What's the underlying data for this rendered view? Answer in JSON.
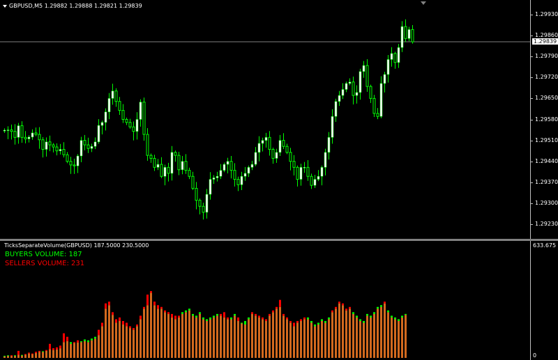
{
  "main_header": {
    "symbol": "GBPUSD,M5",
    "open": "1.29882",
    "high": "1.29888",
    "low": "1.29821",
    "close": "1.29839"
  },
  "sub_header": {
    "indicator": "TicksSeparateVolume(GBPUSD)",
    "value1": "187.5000",
    "value2": "230.5000"
  },
  "buyers_label": "BUYERS VOLUME: 187",
  "sellers_label": "SELLERS VOLUME: 231",
  "current_price": "1.29839",
  "price_ticks": [
    "1.29930",
    "1.29860",
    "1.29790",
    "1.29720",
    "1.29650",
    "1.29580",
    "1.29510",
    "1.29440",
    "1.29370",
    "1.29300",
    "1.29230"
  ],
  "volume_ticks": [
    "633.675",
    "0"
  ],
  "colors": {
    "buy": "#00ff00",
    "sell": "#ff0000",
    "bull": "#ffffff",
    "bear": "#00ff00",
    "grid": "#c0c0c0",
    "volume_fill": "#d2691e"
  },
  "chart_data": [
    {
      "type": "candlestick",
      "title": "GBPUSD,M5",
      "ylim": [
        1.292,
        1.2996
      ],
      "current_price": 1.29839,
      "closes": [
        1.29544,
        1.29545,
        1.2954,
        1.2952,
        1.29559,
        1.2952,
        1.29515,
        1.29521,
        1.29535,
        1.2953,
        1.29512,
        1.2948,
        1.29505,
        1.29495,
        1.29488,
        1.29475,
        1.2948,
        1.29462,
        1.2944,
        1.29428,
        1.29425,
        1.29458,
        1.2951,
        1.29495,
        1.29483,
        1.2949,
        1.29505,
        1.2956,
        1.2957,
        1.29605,
        1.2965,
        1.29675,
        1.2964,
        1.2961,
        1.2958,
        1.2957,
        1.29555,
        1.2954,
        1.2958,
        1.29638,
        1.2953,
        1.2946,
        1.2945,
        1.2942,
        1.2943,
        1.2939,
        1.2942,
        1.294,
        1.2947,
        1.2946,
        1.29412,
        1.2944,
        1.2941,
        1.2939,
        1.2935,
        1.2931,
        1.2929,
        1.2927,
        1.2933,
        1.2938,
        1.29385,
        1.2939,
        1.2941,
        1.2943,
        1.2944,
        1.2941,
        1.2938,
        1.29362,
        1.2939,
        1.294,
        1.2942,
        1.2943,
        1.2947,
        1.295,
        1.2951,
        1.2952,
        1.2948,
        1.2945,
        1.2947,
        1.2951,
        1.2949,
        1.2947,
        1.2944,
        1.2942,
        1.2938,
        1.2942,
        1.2942,
        1.2939,
        1.2936,
        1.2938,
        1.2939,
        1.2942,
        1.2947,
        1.2952,
        1.2959,
        1.2964,
        1.2966,
        1.2968,
        1.297,
        1.29705,
        1.2966,
        1.2967,
        1.2974,
        1.2976,
        1.2969,
        1.2965,
        1.296,
        1.2959,
        1.297,
        1.2973,
        1.2978,
        1.298,
        1.2977,
        1.2982,
        1.2989,
        1.2985,
        1.2988,
        1.29839
      ]
    },
    {
      "type": "bar",
      "title": "TicksSeparateVolume(GBPUSD)",
      "ylim": [
        0,
        633.675
      ],
      "series": [
        {
          "name": "BUYERS VOLUME",
          "values": [
            12,
            15,
            14,
            15,
            18,
            17,
            20,
            25,
            22,
            28,
            35,
            38,
            40,
            50,
            45,
            48,
            55,
            90,
            95,
            90,
            85,
            88,
            95,
            105,
            100,
            110,
            120,
            130,
            180,
            280,
            300,
            245,
            200,
            210,
            190,
            180,
            170,
            160,
            180,
            220,
            280,
            300,
            370,
            300,
            280,
            280,
            260,
            250,
            230,
            220,
            230,
            260,
            270,
            280,
            250,
            240,
            260,
            230,
            220,
            230,
            240,
            250,
            240,
            230,
            220,
            230,
            250,
            210,
            200,
            210,
            230,
            250,
            240,
            230,
            220,
            210,
            240,
            260,
            280,
            290,
            240,
            220,
            200,
            180,
            200,
            210,
            220,
            230,
            210,
            190,
            200,
            220,
            210,
            230,
            260,
            280,
            310,
            300,
            270,
            280,
            260,
            240,
            220,
            210,
            250,
            240,
            260,
            290,
            300,
            310,
            270,
            240,
            230,
            220,
            240,
            250
          ]
        },
        {
          "name": "SELLERS VOLUME",
          "values": [
            10,
            12,
            15,
            14,
            40,
            15,
            22,
            30,
            25,
            35,
            40,
            35,
            45,
            80,
            55,
            60,
            70,
            140,
            120,
            80,
            90,
            100,
            90,
            95,
            90,
            100,
            110,
            160,
            200,
            310,
            320,
            260,
            220,
            230,
            210,
            200,
            180,
            170,
            190,
            240,
            290,
            360,
            380,
            320,
            300,
            290,
            270,
            260,
            250,
            240,
            240,
            250,
            260,
            270,
            240,
            230,
            250,
            220,
            210,
            220,
            230,
            240,
            250,
            260,
            230,
            220,
            240,
            230,
            200,
            190,
            220,
            260,
            250,
            240,
            230,
            220,
            250,
            270,
            290,
            330,
            250,
            230,
            210,
            200,
            210,
            220,
            230,
            220,
            200,
            180,
            190,
            210,
            200,
            220,
            270,
            290,
            320,
            310,
            280,
            290,
            250,
            230,
            210,
            200,
            240,
            230,
            250,
            280,
            290,
            320,
            260,
            230,
            220,
            210,
            230,
            245
          ]
        }
      ]
    }
  ]
}
